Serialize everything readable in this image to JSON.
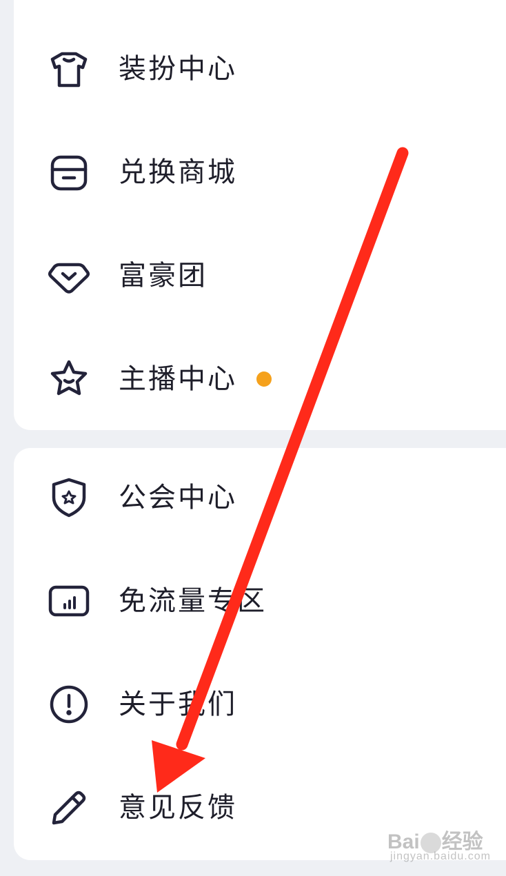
{
  "menu_group_1": [
    {
      "label": "装扮中心",
      "icon": "tshirt-icon"
    },
    {
      "label": "兑换商城",
      "icon": "store-icon"
    },
    {
      "label": "富豪团",
      "icon": "diamond-icon"
    },
    {
      "label": "主播中心",
      "icon": "star-icon",
      "badge_dot": true
    }
  ],
  "menu_group_2": [
    {
      "label": "公会中心",
      "icon": "shield-star-icon"
    },
    {
      "label": "免流量专区",
      "icon": "data-chart-icon"
    },
    {
      "label": "关于我们",
      "icon": "info-exclamation-icon"
    },
    {
      "label": "意见反馈",
      "icon": "pencil-icon"
    }
  ],
  "colors": {
    "page_background": "#eef0f4",
    "card_background": "#ffffff",
    "text": "#1e1e2a",
    "icon_stroke": "#23233a",
    "badge_dot": "#f5a11c",
    "annotation_arrow": "#ff2a1a"
  },
  "annotation": {
    "type": "arrow",
    "points_to": "意见反馈"
  },
  "watermark": {
    "brand_left": "Bai",
    "brand_right": "经验",
    "subtext": "jingyan.baidu.com"
  }
}
